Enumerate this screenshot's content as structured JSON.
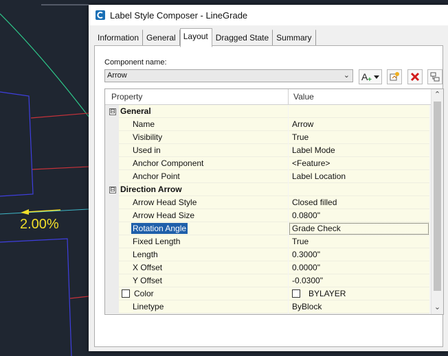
{
  "canvas": {
    "slope_label": "2.00%",
    "colors": {
      "background": "#1f2631",
      "linework_blue": "#3f3fe0",
      "linework_red": "#c8323a",
      "arc_green": "#2ec88a",
      "label_yellow": "#f2df2a"
    }
  },
  "window": {
    "title": "Label Style Composer - LineGrade",
    "app_icon": "civil3d-icon"
  },
  "tabs": [
    {
      "label": "Information",
      "active": false
    },
    {
      "label": "General",
      "active": false
    },
    {
      "label": "Layout",
      "active": true
    },
    {
      "label": "Dragged State",
      "active": false
    },
    {
      "label": "Summary",
      "active": false
    }
  ],
  "component": {
    "label": "Component name:",
    "value": "Arrow",
    "buttons": [
      "add-component-icon",
      "copy-component-icon",
      "delete-icon",
      "reorder-icon"
    ]
  },
  "grid": {
    "headers": {
      "property": "Property",
      "value": "Value"
    },
    "rows": [
      {
        "type": "group",
        "expander": "⊟",
        "label": "General"
      },
      {
        "type": "prop",
        "property": "Name",
        "value": "Arrow"
      },
      {
        "type": "prop",
        "property": "Visibility",
        "value": "True"
      },
      {
        "type": "prop",
        "property": "Used in",
        "value": "Label Mode"
      },
      {
        "type": "prop",
        "property": "Anchor Component",
        "value": "<Feature>"
      },
      {
        "type": "prop",
        "property": "Anchor Point",
        "value": "Label Location"
      },
      {
        "type": "group",
        "expander": "⊟",
        "label": "Direction Arrow"
      },
      {
        "type": "prop",
        "property": "Arrow Head Style",
        "value": "Closed filled"
      },
      {
        "type": "prop",
        "property": "Arrow Head Size",
        "value": "0.0800\""
      },
      {
        "type": "prop",
        "property": "Rotation Angle",
        "value": "Grade Check",
        "selected": true
      },
      {
        "type": "prop",
        "property": "Fixed Length",
        "value": "True"
      },
      {
        "type": "prop",
        "property": "Length",
        "value": "0.3000\""
      },
      {
        "type": "prop",
        "property": "X Offset",
        "value": "0.0000\""
      },
      {
        "type": "prop",
        "property": "Y Offset",
        "value": "-0.0300\""
      },
      {
        "type": "prop",
        "property": "Color",
        "value": "BYLAYER",
        "swatch": true
      },
      {
        "type": "prop",
        "property": "Linetype",
        "value": "ByBlock"
      }
    ]
  }
}
